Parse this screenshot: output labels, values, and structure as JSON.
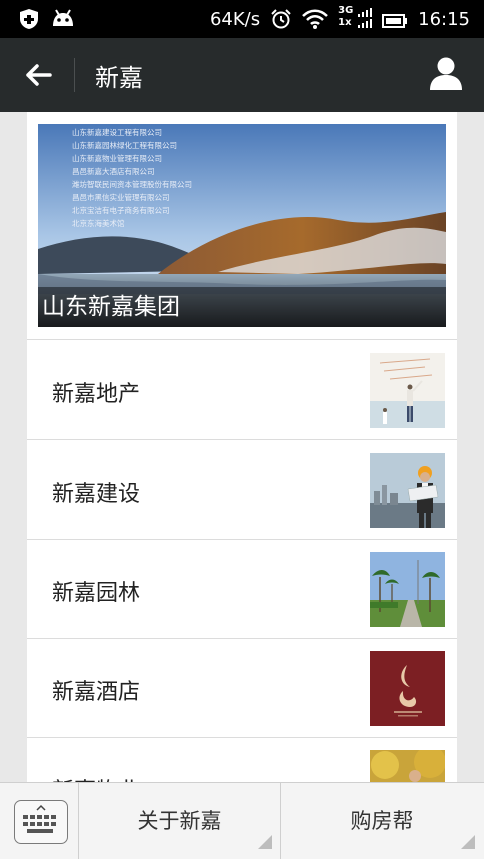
{
  "status_bar": {
    "network_speed": "64K/s",
    "network_type_top": "3G",
    "network_type_bottom": "1x",
    "time": "16:15"
  },
  "header": {
    "title": "新嘉"
  },
  "banner": {
    "caption": "山东新嘉集团",
    "company_lines": [
      "山东新嘉建设工程有限公司",
      "山东新嘉园林绿化工程有限公司",
      "山东新嘉物业管理有限公司",
      "昌邑新嘉大酒店有限公司",
      "潍坊智联民间资本管理股份有限公司",
      "昌邑市黑信实业管理有限公司",
      "北京宝洁有电子商务有限公司",
      "北京东海美术馆"
    ]
  },
  "menu_items": [
    {
      "label": "新嘉地产"
    },
    {
      "label": "新嘉建设"
    },
    {
      "label": "新嘉园林"
    },
    {
      "label": "新嘉酒店"
    },
    {
      "label": "新嘉物业"
    }
  ],
  "bottom_bar": {
    "tab1": "关于新嘉",
    "tab2": "购房帮"
  },
  "colors": {
    "title_bar": "#272b2c",
    "status_bar": "#000000",
    "background": "#e8e8e8"
  }
}
